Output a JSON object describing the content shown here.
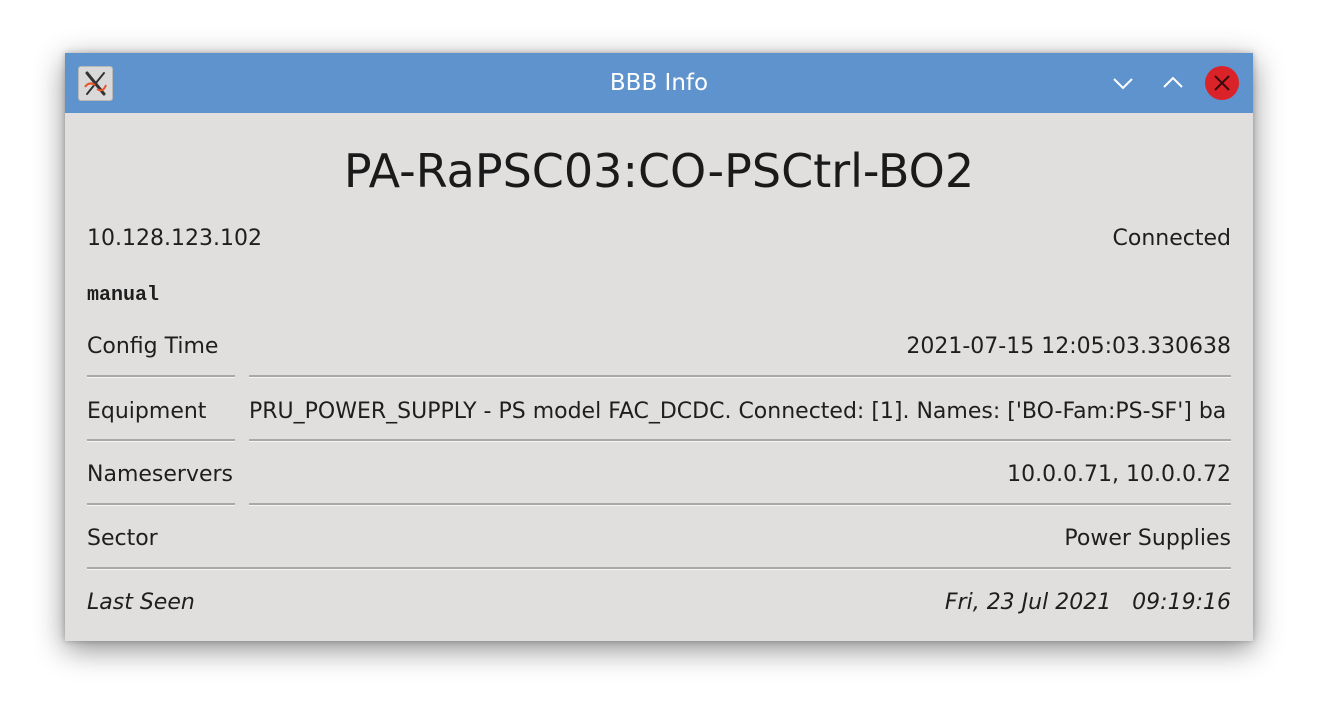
{
  "window": {
    "title": "BBB Info",
    "icons": {
      "app": "x-app-icon",
      "minimize": "chevron-down-icon",
      "maximize": "chevron-up-icon",
      "close": "close-icon"
    }
  },
  "device": {
    "name": "PA-RaPSC03:CO-PSCtrl-BO2",
    "ip": "10.128.123.102",
    "status": "Connected",
    "mode": "manual"
  },
  "fields": {
    "config_time": {
      "label": "Config Time",
      "value": "2021-07-15 12:05:03.330638"
    },
    "equipment": {
      "label": "Equipment",
      "value": "PRU_POWER_SUPPLY -  PS model FAC_DCDC. Connected: [1]. Names: ['BO-Fam:PS-SF'] ba"
    },
    "nameservers": {
      "label": "Nameservers",
      "value": "10.0.0.71, 10.0.0.72"
    },
    "sector": {
      "label": "Sector",
      "value": "Power Supplies"
    },
    "last_seen": {
      "label": "Last Seen",
      "value": "Fri, 23 Jul 2021   09:19:16"
    }
  },
  "colors": {
    "titlebar": "#5f93cd",
    "window_bg": "#e0dfde",
    "close_button": "#da2229"
  }
}
